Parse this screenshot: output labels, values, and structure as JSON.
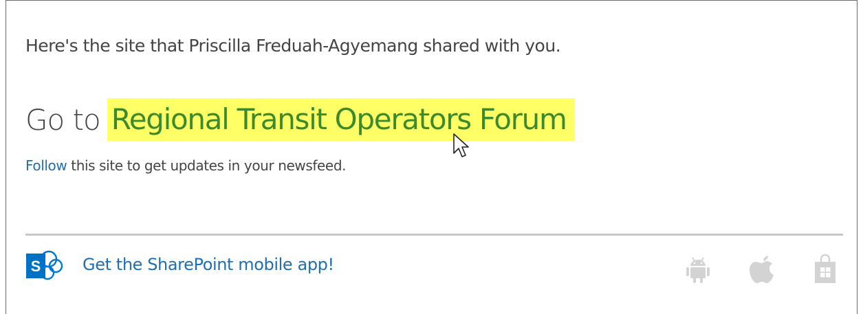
{
  "message": {
    "intro_text": "Here's the site that Priscilla Freduah-Agyemang shared with you.",
    "goto_prefix": "Go to",
    "site_name": "Regional Transit Operators Forum",
    "follow_link": "Follow",
    "follow_text": " this site to get updates in your newsfeed."
  },
  "footer": {
    "app_link_text": "Get the SharePoint mobile app!",
    "logo_letter": "S",
    "platform_icons": [
      "android-icon",
      "apple-icon",
      "windows-store-icon"
    ]
  },
  "colors": {
    "highlight": "#ffff66",
    "site_link": "#3c8a2e",
    "link_blue": "#1f6fb4",
    "body_text": "#444444",
    "sharepoint_blue": "#0078d4",
    "icon_gray": "#d3d3d3"
  }
}
